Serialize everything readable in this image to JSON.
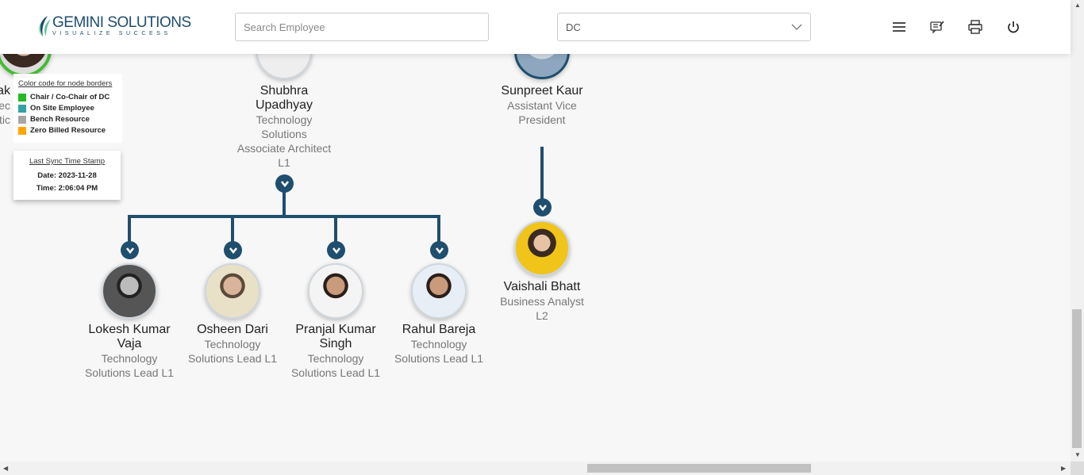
{
  "header": {
    "logo_main": "GEMINI SOLUTIONS",
    "logo_sub": "VISUALIZE SUCCESS",
    "search_placeholder": "Search Employee",
    "search_value": "",
    "select_value": "DC",
    "icons": [
      "menu-icon",
      "feedback-icon",
      "print-icon",
      "power-icon"
    ]
  },
  "legend": {
    "title": "Color code for node borders",
    "items": [
      {
        "label": "Chair / Co-Chair of DC",
        "color": "#22bb22"
      },
      {
        "label": "On Site Employee",
        "color": "#34a0a4"
      },
      {
        "label": "Bench Resource",
        "color": "#a6a6a6"
      },
      {
        "label": "Zero Billed Resource",
        "color": "#ffa500"
      }
    ]
  },
  "sync": {
    "title": "Last Sync Time Stamp",
    "date": "Date: 2023-11-28",
    "time": "Time: 2:06:04 PM"
  },
  "colors": {
    "connector": "#1f4e6e",
    "chair_border": "#44bb33"
  },
  "nodes": {
    "partial": {
      "name": "lak",
      "l1": "Tec",
      "l2": "utic"
    },
    "shubhra": {
      "name": "Shubhra Upadhyay",
      "l1": "Technology Solutions",
      "l2": "Associate Architect",
      "l3": "L1"
    },
    "sunpreet": {
      "name": "Sunpreet Kaur",
      "l1": "Assistant Vice President"
    },
    "vaishali": {
      "name": "Vaishali Bhatt",
      "l1": "Business Analyst",
      "l2": "L2"
    },
    "children": [
      {
        "name": "Lokesh Kumar Vaja",
        "l1": "Technology Solutions Lead L1"
      },
      {
        "name": "Osheen Dari",
        "l1": "Technology Solutions Lead L1"
      },
      {
        "name": "Pranjal Kumar Singh",
        "l1": "Technology Solutions Lead L1"
      },
      {
        "name": "Rahul Bareja",
        "l1": "Technology Solutions Lead L1"
      }
    ]
  }
}
